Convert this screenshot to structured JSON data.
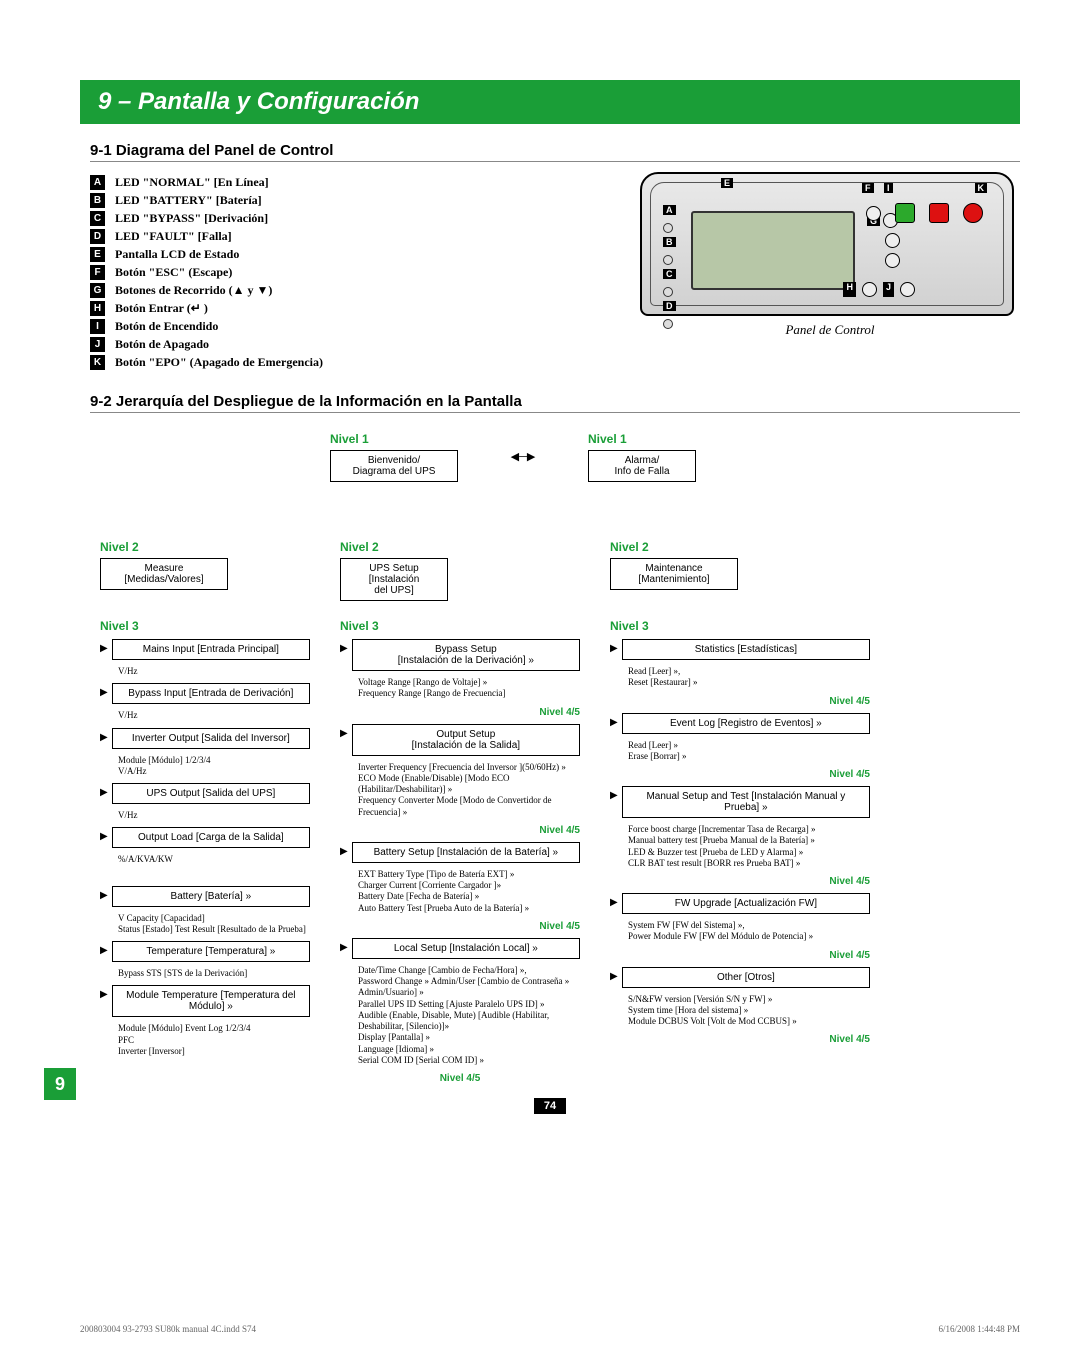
{
  "banner": "9 – Pantalla y Configuración",
  "sub1": "9-1 Diagrama del Panel de Control",
  "sub2": "9-2 Jerarquía del Despliegue de la Información en la Pantalla",
  "side_tab": "9",
  "page_num": "74",
  "footer_left": "200803004 93-2793 SU80k manual 4C.indd   S74",
  "footer_right": "6/16/2008   1:44:48 PM",
  "panel_caption": "Panel de Control",
  "legend": [
    {
      "k": "A",
      "t": "LED \"NORMAL\" [En Línea]"
    },
    {
      "k": "B",
      "t": "LED \"BATTERY\" [Batería]"
    },
    {
      "k": "C",
      "t": "LED \"BYPASS\" [Derivación]"
    },
    {
      "k": "D",
      "t": "LED \"FAULT\" [Falla]"
    },
    {
      "k": "E",
      "t": "Pantalla LCD de Estado"
    },
    {
      "k": "F",
      "t": "Botón \"ESC\" (Escape)"
    },
    {
      "k": "G",
      "t": "Botones de Recorrido (▲ y ▼)"
    },
    {
      "k": "H",
      "t": "Botón Entrar (↵ )"
    },
    {
      "k": "I",
      "t": "Botón de Encendido"
    },
    {
      "k": "J",
      "t": "Botón de Apagado"
    },
    {
      "k": "K",
      "t": "Botón \"EPO\" (Apagado de Emergencia)"
    }
  ],
  "lvl": {
    "n1": "Nivel 1",
    "n2": "Nivel 2",
    "n3": "Nivel 3",
    "n45": "Nivel 4/5"
  },
  "n1a": "Bienvenido/\nDiagrama del UPS",
  "n1b": "Alarma/\nInfo de Falla",
  "n2a": "Measure\n[Medidas/Valores]",
  "n2b": "UPS Setup\n[Instalación\ndel UPS]",
  "n2c": "Maintenance\n[Mantenimiento]",
  "measure": {
    "mains": "Mains Input [Entrada Principal]",
    "mains_d": "V/Hz",
    "bypass_in": "Bypass Input [Entrada de Derivación]",
    "bypass_d": "V/Hz",
    "inverter": "Inverter Output [Salida del Inversor]",
    "inverter_d": "Module [Módulo] 1/2/3/4\nV/A/Hz",
    "ups_out": "UPS Output [Salida del UPS]",
    "ups_out_d": "V/Hz",
    "load": "Output Load [Carga de la Salida]",
    "load_d": "%/A/KVA/KW",
    "battery": "Battery [Batería] »",
    "battery_d": "V                 Capacity [Capacidad]\nStatus [Estado]   Test Result [Resultado de la Prueba]",
    "temp": "Temperature [Temperatura] »",
    "temp_d": "Bypass STS [STS de la Derivación]",
    "modtemp": "Module Temperature [Temperatura del Módulo] »",
    "modtemp_d": "Module [Módulo] Event Log 1/2/3/4\nPFC\nInverter [Inversor]"
  },
  "ups": {
    "bypass": "Bypass Setup\n[Instalación de la Derivación] »",
    "bypass_d": "Voltage Range [Rango de Voltaje] »\nFrequency Range [Rango de Frecuencia]",
    "output": "Output Setup\n[Instalación de la Salida]",
    "output_d": "Inverter Frequency [Frecuencia del Inversor ](50/60Hz) »\nECO Mode (Enable/Disable) [Modo ECO (Habilitar/Deshabilitar)] »\nFrequency Converter Mode [Modo de Convertidor de Frecuencia] »",
    "batt": "Battery Setup [Instalación de la Batería] »",
    "batt_d": "EXT Battery Type [Tipo de Batería EXT] »\nCharger Current [Corriente Cargador ]»\nBattery Date [Fecha de Batería] »\nAuto Battery Test [Prueba Auto de la Batería] »",
    "local": "Local Setup [Instalación Local] »",
    "local_d": "Date/Time Change [Cambio de Fecha/Hora] »,\nPassword Change » Admin/User [Cambio de Contraseña » Admin/Usuario] »\nParallel UPS ID Setting [Ajuste Paralelo UPS ID] »\nAudible (Enable, Disable, Mute) [Audible (Habilitar, Deshabilitar, [Silencio)]»\nDisplay [Pantalla] »\nLanguage [Idioma] »\nSerial COM ID [Serial COM ID] »"
  },
  "maint": {
    "stats": "Statistics [Estadísticas]",
    "stats_d": "Read [Leer] »,\nReset [Restaurar] »",
    "event": "Event Log [Registro de Eventos] »",
    "event_d": "Read [Leer] »\nErase [Borrar] »",
    "manual": "Manual Setup and Test [Instalación Manual y Prueba] »",
    "manual_d": "Force boost charge [Incrementar Tasa de Recarga] »\nManual battery test [Prueba Manual de la Batería] »\nLED & Buzzer test [Prueba de LED y Alarma] »\nCLR BAT test result [BORR res Prueba BAT] »",
    "fw": "FW Upgrade [Actualización FW]",
    "fw_d": "System FW [FW del Sistema] »,\nPower Module FW [FW del Módulo de Potencia] »",
    "other": "Other [Otros]",
    "other_d": "S/N&FW version [Versión S/N y FW] »\nSystem time [Hora del sistema] »\nModule DCBUS Volt [Volt de Mod CCBUS] »"
  }
}
